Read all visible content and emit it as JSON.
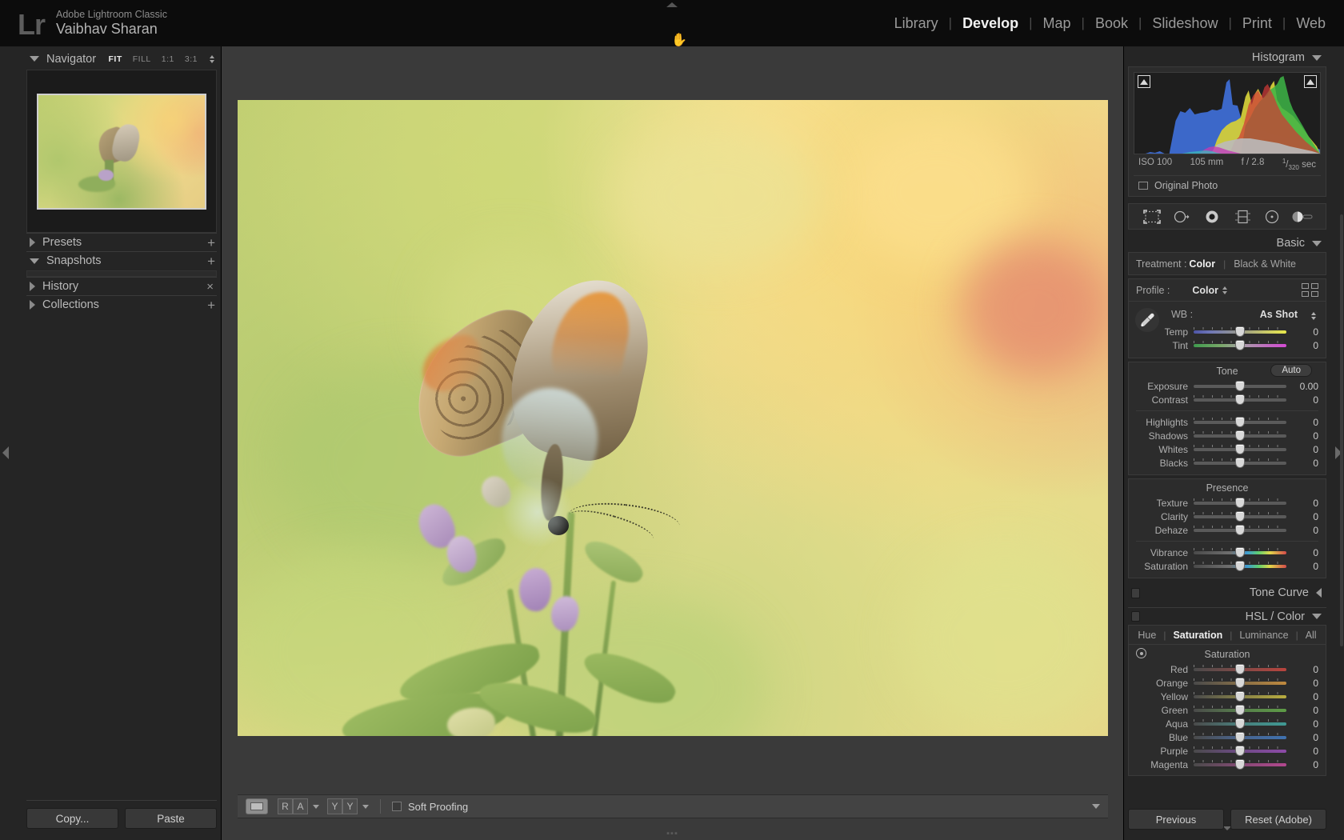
{
  "app": {
    "logo": "Lr",
    "product": "Adobe Lightroom Classic",
    "user": "Vaibhav Sharan"
  },
  "modules": [
    {
      "label": "Library",
      "active": false
    },
    {
      "label": "Develop",
      "active": true
    },
    {
      "label": "Map",
      "active": false
    },
    {
      "label": "Book",
      "active": false
    },
    {
      "label": "Slideshow",
      "active": false
    },
    {
      "label": "Print",
      "active": false
    },
    {
      "label": "Web",
      "active": false
    }
  ],
  "left_panel": {
    "navigator": {
      "title": "Navigator",
      "modes": [
        "FIT",
        "FILL",
        "1:1",
        "3:1"
      ],
      "active_mode": "FIT"
    },
    "sections": [
      {
        "title": "Presets",
        "expanded": false,
        "action": "+"
      },
      {
        "title": "Snapshots",
        "expanded": true,
        "action": "+"
      },
      {
        "title": "History",
        "expanded": false,
        "action": "×"
      },
      {
        "title": "Collections",
        "expanded": false,
        "action": "+"
      }
    ],
    "copy_label": "Copy...",
    "paste_label": "Paste"
  },
  "center": {
    "toolbar": {
      "loupe_view": "loupe-view",
      "before_after_ra": [
        "R",
        "A"
      ],
      "before_after_yy": [
        "Y",
        "Y"
      ],
      "soft_proofing_label": "Soft Proofing",
      "soft_proofing_checked": false
    }
  },
  "right_panel": {
    "histogram": {
      "title": "Histogram",
      "iso": "ISO 100",
      "focal": "105 mm",
      "aperture": "f / 2.8",
      "shutter_num": "1",
      "shutter_den": "320",
      "shutter_unit": "sec",
      "original_photo_label": "Original Photo",
      "original_photo_checked": false
    },
    "tools": [
      "crop-overlay-icon",
      "spot-removal-icon",
      "red-eye-icon",
      "graduated-filter-icon",
      "radial-filter-icon",
      "adjustment-brush-icon"
    ],
    "basic": {
      "title": "Basic",
      "treatment_label": "Treatment :",
      "treatment_options": [
        "Color",
        "Black & White"
      ],
      "treatment_active": "Color",
      "profile_label": "Profile :",
      "profile_value": "Color",
      "wb_label": "WB :",
      "wb_value": "As Shot",
      "wb_sliders": [
        {
          "name": "Temp",
          "value": "0"
        },
        {
          "name": "Tint",
          "value": "0"
        }
      ],
      "tone_title": "Tone",
      "auto_label": "Auto",
      "tone_sliders": [
        {
          "name": "Exposure",
          "value": "0.00"
        },
        {
          "name": "Contrast",
          "value": "0"
        }
      ],
      "tone_sliders2": [
        {
          "name": "Highlights",
          "value": "0"
        },
        {
          "name": "Shadows",
          "value": "0"
        },
        {
          "name": "Whites",
          "value": "0"
        },
        {
          "name": "Blacks",
          "value": "0"
        }
      ],
      "presence_title": "Presence",
      "presence_sliders": [
        {
          "name": "Texture",
          "value": "0"
        },
        {
          "name": "Clarity",
          "value": "0"
        },
        {
          "name": "Dehaze",
          "value": "0"
        }
      ],
      "vibrance_sliders": [
        {
          "name": "Vibrance",
          "value": "0"
        },
        {
          "name": "Saturation",
          "value": "0"
        }
      ]
    },
    "tone_curve": {
      "title": "Tone Curve",
      "expanded": false
    },
    "hsl": {
      "title": "HSL / Color",
      "expanded": true,
      "tabs": [
        "Hue",
        "Saturation",
        "Luminance",
        "All"
      ],
      "active_tab": "Saturation",
      "section_title": "Saturation",
      "sliders": [
        {
          "name": "Red",
          "value": "0",
          "color": "#b9443d"
        },
        {
          "name": "Orange",
          "value": "0",
          "color": "#c08a3e"
        },
        {
          "name": "Yellow",
          "value": "0",
          "color": "#b9ad3f"
        },
        {
          "name": "Green",
          "value": "0",
          "color": "#5d9c46"
        },
        {
          "name": "Aqua",
          "value": "0",
          "color": "#3f9a94"
        },
        {
          "name": "Blue",
          "value": "0",
          "color": "#3f72b0"
        },
        {
          "name": "Purple",
          "value": "0",
          "color": "#8d4aa8"
        },
        {
          "name": "Magenta",
          "value": "0",
          "color": "#b3478f"
        }
      ]
    },
    "previous_label": "Previous",
    "reset_label": "Reset (Adobe)"
  },
  "colors": {
    "panel_bg": "#252525",
    "center_bg": "#3a3a3a",
    "topbar_bg": "#0c0c0c",
    "text_primary": "#f0f0f0",
    "text_secondary": "#a8a8a8"
  }
}
